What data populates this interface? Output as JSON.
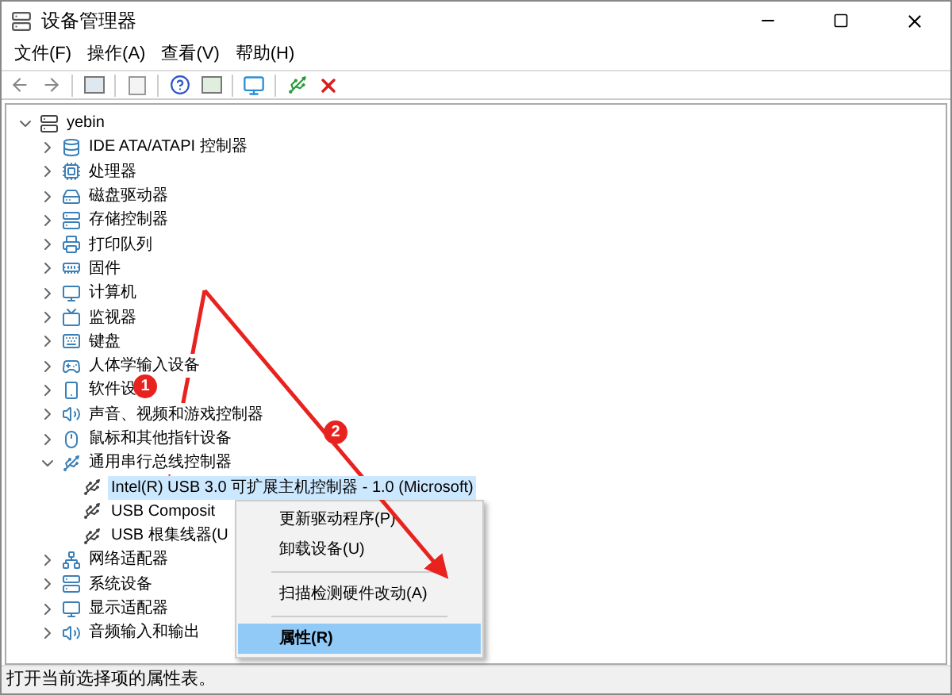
{
  "window": {
    "title": "设备管理器"
  },
  "menu": [
    "文件(F)",
    "操作(A)",
    "查看(V)",
    "帮助(H)"
  ],
  "tree": {
    "label": "yebin",
    "expanded": true,
    "children": [
      {
        "label": "IDE ATA/ATAPI 控制器",
        "expanded": false
      },
      {
        "label": "处理器",
        "expanded": false
      },
      {
        "label": "磁盘驱动器",
        "expanded": false
      },
      {
        "label": "存储控制器",
        "expanded": false
      },
      {
        "label": "打印队列",
        "expanded": false
      },
      {
        "label": "固件",
        "expanded": false
      },
      {
        "label": "计算机",
        "expanded": false
      },
      {
        "label": "监视器",
        "expanded": false
      },
      {
        "label": "键盘",
        "expanded": false
      },
      {
        "label": "人体学输入设备",
        "expanded": false
      },
      {
        "label": "软件设",
        "expanded": false
      },
      {
        "label": "声音、视频和游戏控制器",
        "expanded": false
      },
      {
        "label": "鼠标和其他指针设备",
        "expanded": false
      },
      {
        "label": "通用串行总线控制器",
        "expanded": true,
        "children": [
          {
            "label": "Intel(R) USB 3.0 可扩展主机控制器 - 1.0 (Microsoft)",
            "selected": true
          },
          {
            "label": "USB Composit",
            "selected": false
          },
          {
            "label": "USB 根集线器(U",
            "selected": false
          }
        ]
      },
      {
        "label": "网络适配器",
        "expanded": false
      },
      {
        "label": "系统设备",
        "expanded": false
      },
      {
        "label": "显示适配器",
        "expanded": false
      },
      {
        "label": "音频输入和输出",
        "expanded": false
      }
    ]
  },
  "context_menu": [
    {
      "label": "更新驱动程序(P)",
      "selected": false
    },
    {
      "label": "卸载设备(U)",
      "selected": false
    },
    {
      "label": "扫描检测硬件改动(A)",
      "selected": false
    },
    {
      "label": "属性(R)",
      "selected": true
    }
  ],
  "annotations": [
    "1",
    "2"
  ],
  "status_bar": "打开当前选择项的属性表。"
}
